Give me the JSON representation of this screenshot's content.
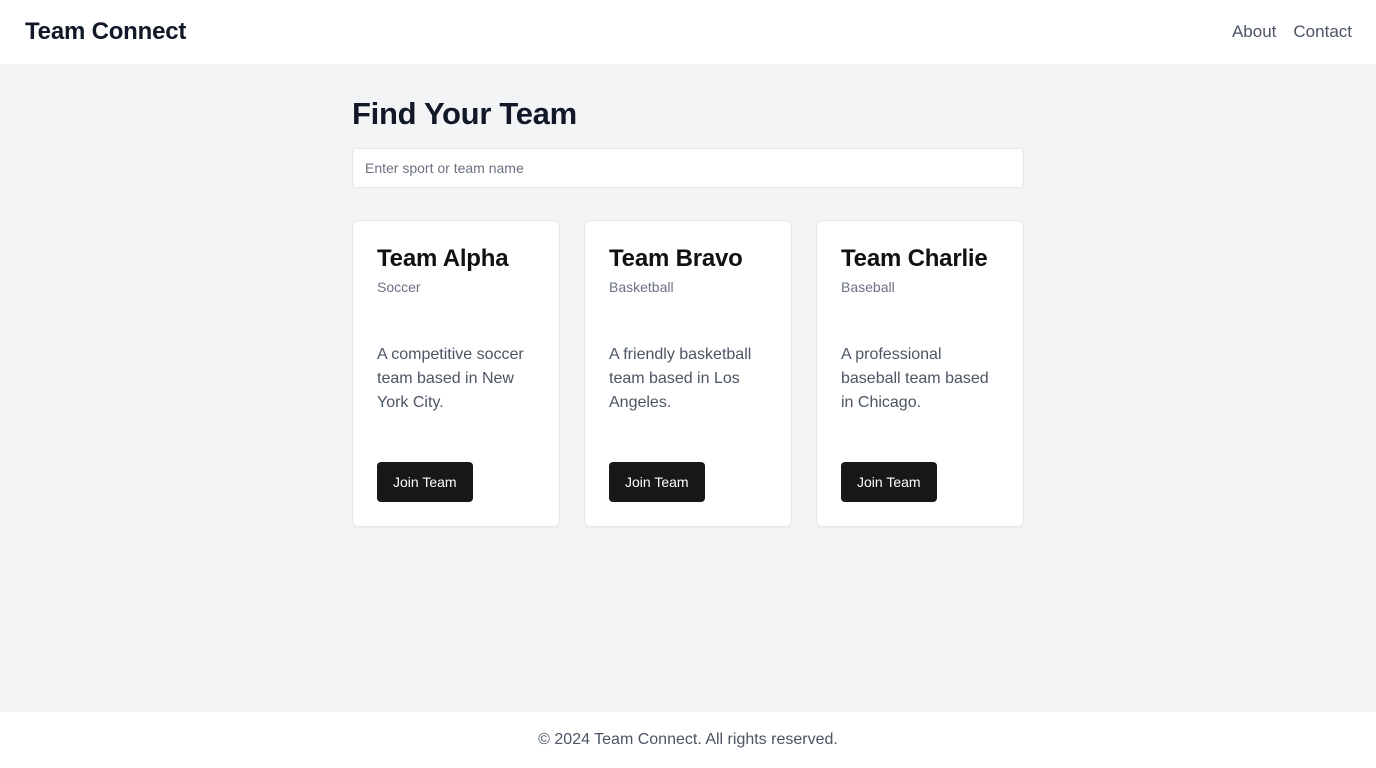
{
  "header": {
    "brand": "Team Connect",
    "nav": [
      {
        "label": "About"
      },
      {
        "label": "Contact"
      }
    ]
  },
  "main": {
    "title": "Find Your Team",
    "search": {
      "placeholder": "Enter sport or team name",
      "value": ""
    },
    "teams": [
      {
        "name": "Team Alpha",
        "sport": "Soccer",
        "description": "A competitive soccer team based in New York City.",
        "button_label": "Join Team"
      },
      {
        "name": "Team Bravo",
        "sport": "Basketball",
        "description": "A friendly basketball team based in Los Angeles.",
        "button_label": "Join Team"
      },
      {
        "name": "Team Charlie",
        "sport": "Baseball",
        "description": "A professional baseball team based in Chicago.",
        "button_label": "Join Team"
      }
    ]
  },
  "footer": {
    "text": "© 2024 Team Connect. All rights reserved."
  },
  "colors": {
    "page_background": "#f3f4f6",
    "surface": "#ffffff",
    "button_background": "#18181b",
    "heading_text": "#111827",
    "muted_text": "#6b7280",
    "body_text": "#4b5563",
    "border": "#e5e7eb"
  }
}
